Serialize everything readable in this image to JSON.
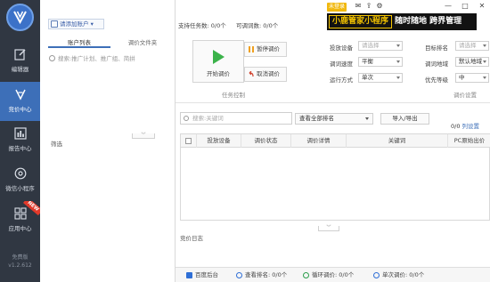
{
  "nav": {
    "items": [
      {
        "label": "编辑器",
        "icon": "edit-icon"
      },
      {
        "label": "竞价中心",
        "icon": "bid-icon"
      },
      {
        "label": "报告中心",
        "icon": "report-icon"
      },
      {
        "label": "微信小程序",
        "icon": "wechat-icon"
      },
      {
        "label": "应用中心",
        "icon": "apps-icon"
      }
    ],
    "new_badge": "NEW",
    "edition": "免费版",
    "version": "v1.2.612"
  },
  "account": {
    "add_account": "请添加账户",
    "tabs": [
      "账户列表",
      "调价文件夹"
    ],
    "search_placeholder": "搜索:推广计划、推广组、简拼",
    "filter_label": "筛选"
  },
  "header": {
    "supported_tasks": "支持任务数: 0/0个",
    "available_bids": "可调词数: 0/0个",
    "login_badge": "未登录",
    "brand_box": "小鹿管家小程序",
    "brand_rest": "随时随地 跨界管理"
  },
  "task_control": {
    "start_label": "开始调价",
    "pause_label": "暂停调价",
    "cancel_label": "取消调价",
    "caption": "任务控制"
  },
  "bid_settings": {
    "caption": "调价设置",
    "rows": [
      {
        "label": "投放设备",
        "value": "请选择",
        "placeholder": true,
        "label2": "目标排名",
        "value2": "请选择",
        "placeholder2": true
      },
      {
        "label": "调词速度",
        "value": "平衡",
        "placeholder": false,
        "label2": "调词地域",
        "value2": "默认地域",
        "placeholder2": false
      },
      {
        "label": "运行方式",
        "value": "单次",
        "placeholder": false,
        "label2": "优先等级",
        "value2": "中",
        "placeholder2": false
      }
    ]
  },
  "keywords": {
    "search_placeholder": "搜索:关键词",
    "view_select": "查看全部排名",
    "io_button": "导入/导出",
    "count": "0/0",
    "column_settings": "列设置",
    "columns": [
      "投放设备",
      "调价状态",
      "调价详情",
      "关键词",
      "PC原始出价"
    ]
  },
  "log": {
    "title": "竞价日志"
  },
  "status": {
    "baidu_backend": "百度后台",
    "check_rank": "查看排名: 0/0个",
    "loop_bid": "循环调价: 0/0个",
    "single_bid": "单次调价: 0/0个"
  }
}
